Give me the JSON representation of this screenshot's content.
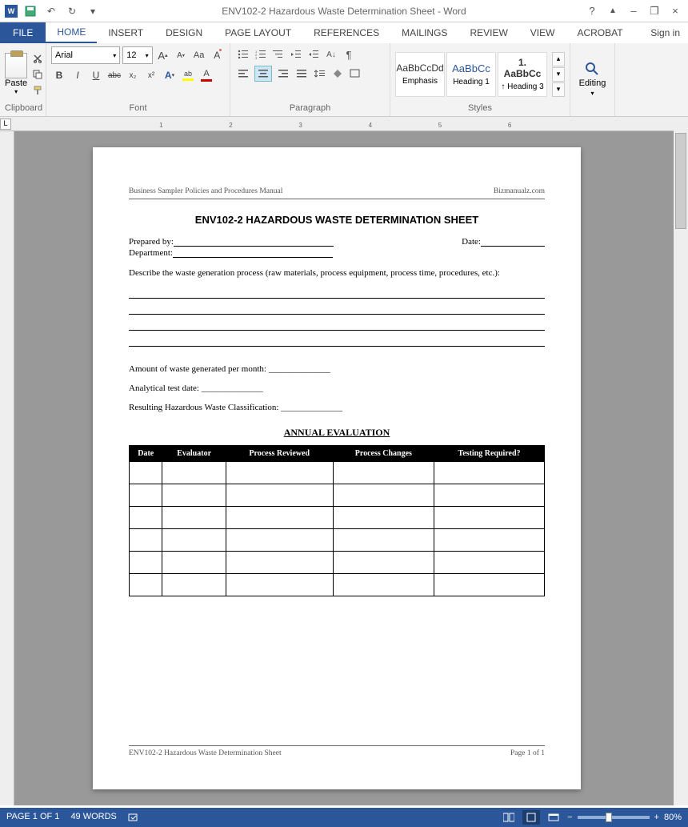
{
  "titlebar": {
    "title": "ENV102-2 Hazardous Waste Determination Sheet - Word",
    "help": "?",
    "ribbon_toggle": "▲",
    "minimize": "–",
    "restore": "❐",
    "close": "×"
  },
  "tabs": {
    "file": "FILE",
    "items": [
      "HOME",
      "INSERT",
      "DESIGN",
      "PAGE LAYOUT",
      "REFERENCES",
      "MAILINGS",
      "REVIEW",
      "VIEW",
      "ACROBAT"
    ],
    "active": "HOME",
    "signin": "Sign in"
  },
  "ribbon": {
    "clipboard": {
      "label": "Clipboard",
      "paste": "Paste"
    },
    "font": {
      "label": "Font",
      "face": "Arial",
      "size": "12",
      "increase": "A",
      "decrease": "A",
      "changecase": "Aa",
      "clear": "⌫",
      "bold": "B",
      "italic": "I",
      "under": "U",
      "strike": "abc",
      "sub": "x₂",
      "sup": "x²",
      "texteffects": "A",
      "highlight": "ab",
      "fontcolor": "A"
    },
    "paragraph": {
      "label": "Paragraph",
      "showpara": "¶"
    },
    "styles": {
      "label": "Styles",
      "items": [
        {
          "preview": "AaBbCcDd",
          "name": "Emphasis",
          "cls": "emph"
        },
        {
          "preview": "AaBbCc",
          "name": "Heading 1",
          "cls": "h1"
        },
        {
          "preview": "1. AaBbCc",
          "name": "↑ Heading 3",
          "cls": "h3"
        }
      ]
    },
    "editing": {
      "label": "Editing"
    }
  },
  "ruler": {
    "nums": [
      "1",
      "2",
      "3",
      "4",
      "5",
      "6"
    ]
  },
  "document": {
    "header_left": "Business Sampler Policies and Procedures Manual",
    "header_right": "Bizmanualz.com",
    "title": "ENV102-2   HAZARDOUS WASTE DETERMINATION SHEET",
    "prepared_by": "Prepared by:",
    "date": "Date:",
    "department": "Department:",
    "describe": "Describe the waste generation process (raw materials, process equipment, process time, procedures, etc.):",
    "amount": "Amount of waste generated per month: ______________",
    "analytical": "Analytical test date: ______________",
    "resulting": "Resulting Hazardous Waste Classification: ______________",
    "annual_eval": "ANNUAL EVALUATION",
    "table_headers": [
      "Date",
      "Evaluator",
      "Process Reviewed",
      "Process Changes",
      "Testing Required?"
    ],
    "table_rows": 6,
    "footer_left": "ENV102-2 Hazardous Waste Determination Sheet",
    "footer_right": "Page 1 of 1"
  },
  "status": {
    "page": "PAGE 1 OF 1",
    "words": "49 WORDS",
    "zoom": "80%",
    "minus": "−",
    "plus": "+"
  }
}
